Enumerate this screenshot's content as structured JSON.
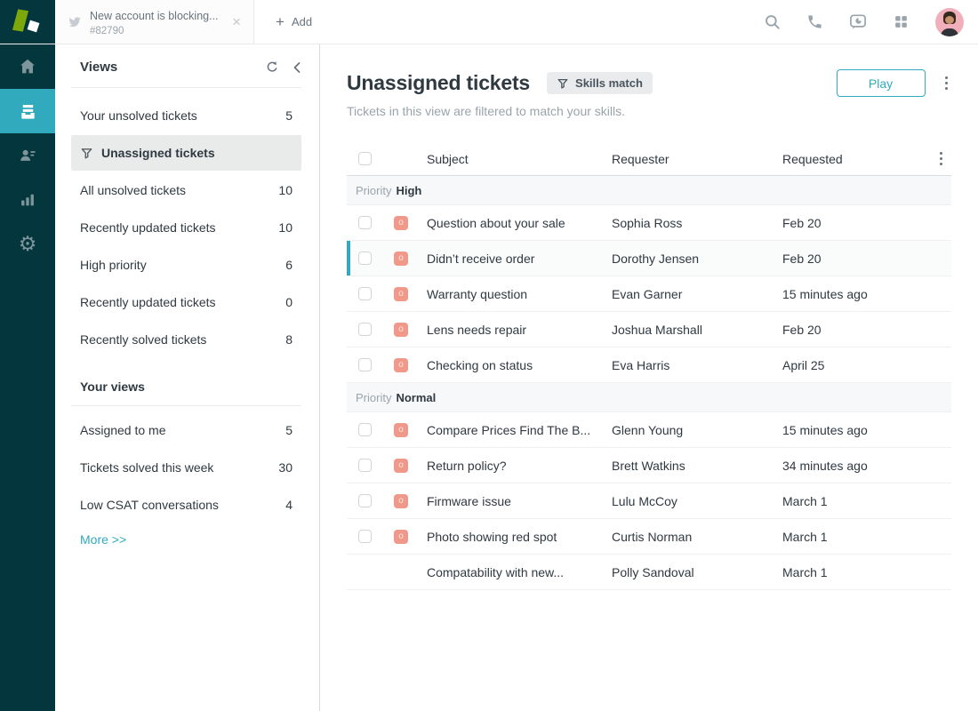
{
  "colors": {
    "accent_teal": "#30aabc",
    "sidebar_dark": "#03363d",
    "logo_green": "#7ca80b",
    "status_badge_salmon": "#f0988a",
    "selected_view_bg": "#e9eaea"
  },
  "topbar": {
    "tab_title": "New account is blocking...",
    "tab_id": "#82790",
    "add_label": "Add"
  },
  "rail": {
    "items": [
      "home",
      "views",
      "customers",
      "reporting",
      "settings"
    ],
    "active": "views"
  },
  "views_panel": {
    "title": "Views",
    "items": [
      {
        "label": "Your unsolved tickets",
        "count": "5"
      },
      {
        "label": "Unassigned tickets",
        "count": "",
        "selected": true
      },
      {
        "label": "All unsolved tickets",
        "count": "10"
      },
      {
        "label": "Recently updated tickets",
        "count": "10"
      },
      {
        "label": "High priority",
        "count": "6"
      },
      {
        "label": "Recently updated tickets",
        "count": "0"
      },
      {
        "label": "Recently solved tickets",
        "count": "8"
      }
    ],
    "your_views_title": "Your views",
    "your_views": [
      {
        "label": "Assigned to me",
        "count": "5"
      },
      {
        "label": "Tickets solved this week",
        "count": "30"
      },
      {
        "label": "Low CSAT conversations",
        "count": "4"
      }
    ],
    "more_label": "More >>"
  },
  "main": {
    "title": "Unassigned tickets",
    "filter_badge": "Skills match",
    "subtitle": "Tickets in this view are filtered to match your skills.",
    "play_label": "Play"
  },
  "table": {
    "headers": {
      "subject": "Subject",
      "requester": "Requester",
      "requested": "Requested"
    },
    "groups": [
      {
        "prefix": "Priority",
        "name": "High",
        "rows": [
          {
            "status": "o",
            "subject": "Question about your sale",
            "requester": "Sophia Ross",
            "requested": "Feb 20"
          },
          {
            "status": "o",
            "subject": "Didn’t receive order",
            "requester": "Dorothy Jensen",
            "requested": "Feb 20",
            "current": true
          },
          {
            "status": "o",
            "subject": "Warranty question",
            "requester": "Evan Garner",
            "requested": "15 minutes ago"
          },
          {
            "status": "o",
            "subject": "Lens needs repair",
            "requester": "Joshua Marshall",
            "requested": "Feb 20"
          },
          {
            "status": "o",
            "subject": "Checking on status",
            "requester": "Eva Harris",
            "requested": "April 25"
          }
        ]
      },
      {
        "prefix": "Priority",
        "name": "Normal",
        "rows": [
          {
            "status": "o",
            "subject": "Compare Prices Find The B...",
            "requester": "Glenn Young",
            "requested": "15 minutes ago"
          },
          {
            "status": "o",
            "subject": "Return policy?",
            "requester": "Brett Watkins",
            "requested": "34 minutes ago"
          },
          {
            "status": "o",
            "subject": "Firmware issue",
            "requester": "Lulu McCoy",
            "requested": "March 1"
          },
          {
            "status": "o",
            "subject": "Photo showing red spot",
            "requester": "Curtis Norman",
            "requested": "March 1"
          },
          {
            "status": "",
            "subject": "Compatability with new...",
            "requester": "Polly Sandoval",
            "requested": "March 1"
          }
        ]
      }
    ]
  }
}
